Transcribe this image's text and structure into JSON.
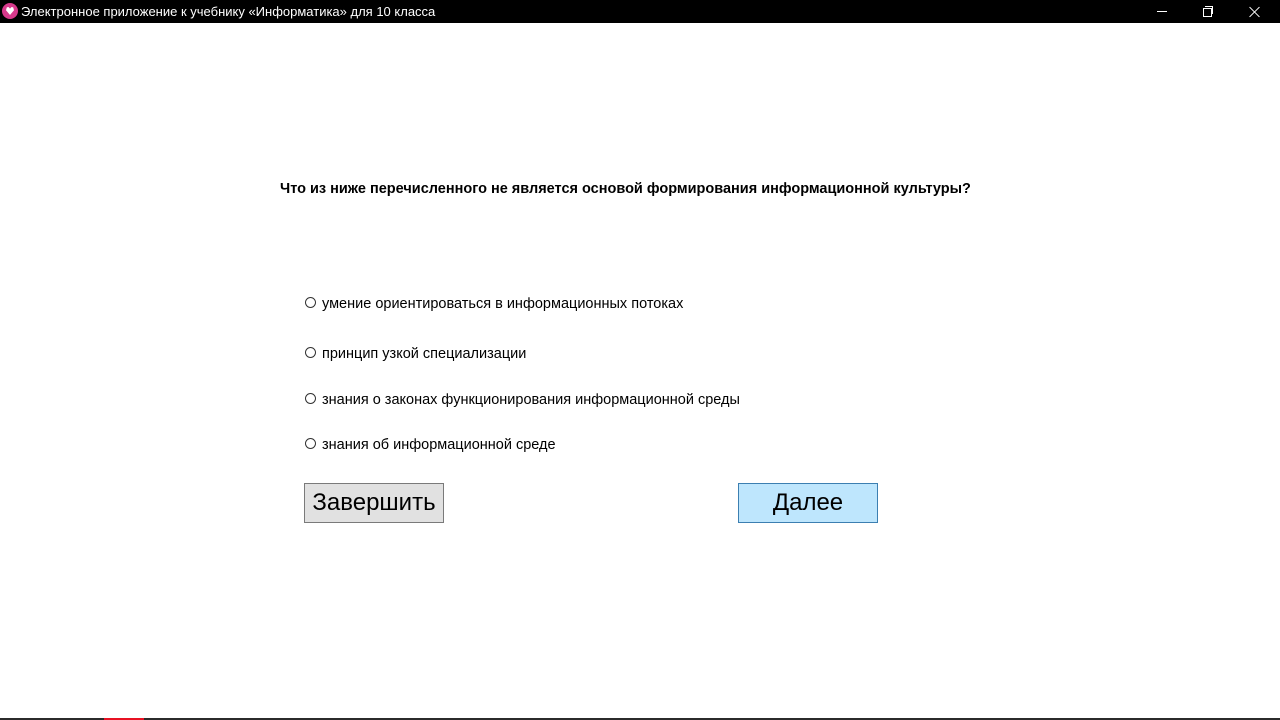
{
  "window": {
    "title": "Электронное приложение к учебнику «Информатика» для 10 класса",
    "icon": "heart-app-icon",
    "controls": {
      "minimize_icon": "minimize-icon",
      "restore_icon": "restore-icon",
      "close_icon": "close-icon"
    }
  },
  "quiz": {
    "question": "Что из ниже перечисленного не является основой формирования информационной культуры?",
    "options": [
      {
        "label": "умение ориентироваться в информационных потоках",
        "selected": false
      },
      {
        "label": "принцип узкой специализации",
        "selected": false
      },
      {
        "label": "знания о законах функционирования информационной среды",
        "selected": false
      },
      {
        "label": "знания об информационной среде",
        "selected": false
      }
    ]
  },
  "buttons": {
    "finish_label": "Завершить",
    "next_label": "Далее"
  },
  "colors": {
    "titlebar_bg": "#000000",
    "finish_bg": "#e1e1e1",
    "next_bg": "#bee6fd",
    "next_border": "#3c7fb1",
    "app_icon": "#d83a8c"
  }
}
